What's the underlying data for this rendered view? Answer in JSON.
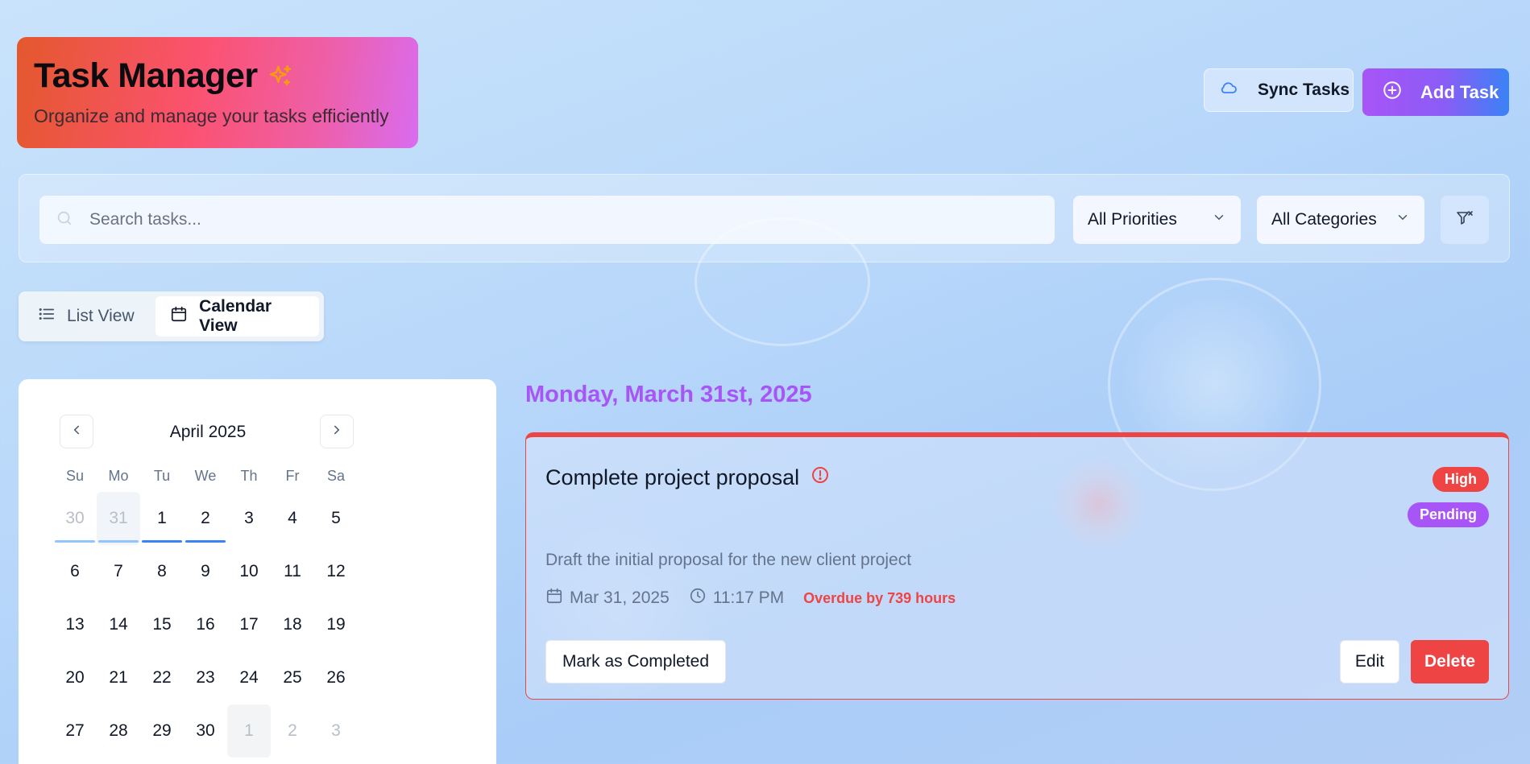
{
  "header": {
    "title": "Task Manager",
    "subtitle": "Organize and manage your tasks efficiently",
    "title_icon": "sparkles-icon",
    "sync_label": "Sync Tasks",
    "add_label": "Add Task"
  },
  "filters": {
    "search_placeholder": "Search tasks...",
    "priority_value": "All Priorities",
    "category_value": "All Categories"
  },
  "views": {
    "list_label": "List View",
    "calendar_label": "Calendar View",
    "active": "calendar"
  },
  "calendar": {
    "month_label": "April 2025",
    "weekdays": [
      "Su",
      "Mo",
      "Tu",
      "We",
      "Th",
      "Fr",
      "Sa"
    ],
    "weeks": [
      [
        "30",
        "31",
        "1",
        "2",
        "3",
        "4",
        "5"
      ],
      [
        "6",
        "7",
        "8",
        "9",
        "10",
        "11",
        "12"
      ],
      [
        "13",
        "14",
        "15",
        "16",
        "17",
        "18",
        "19"
      ],
      [
        "20",
        "21",
        "22",
        "23",
        "24",
        "25",
        "26"
      ],
      [
        "27",
        "28",
        "29",
        "30",
        "1",
        "2",
        "3"
      ]
    ]
  },
  "selected_day": {
    "heading": "Monday, March 31st, 2025"
  },
  "task": {
    "title": "Complete project proposal",
    "priority": "High",
    "status": "Pending",
    "description": "Draft the initial proposal for the new client project",
    "date": "Mar 31, 2025",
    "time": "11:17 PM",
    "overdue": "Overdue by 739 hours",
    "complete_label": "Mark as Completed",
    "edit_label": "Edit",
    "delete_label": "Delete"
  },
  "colors": {
    "accent_purple": "#a855f7",
    "danger_red": "#ef4444",
    "accent_blue": "#3b82f6"
  }
}
